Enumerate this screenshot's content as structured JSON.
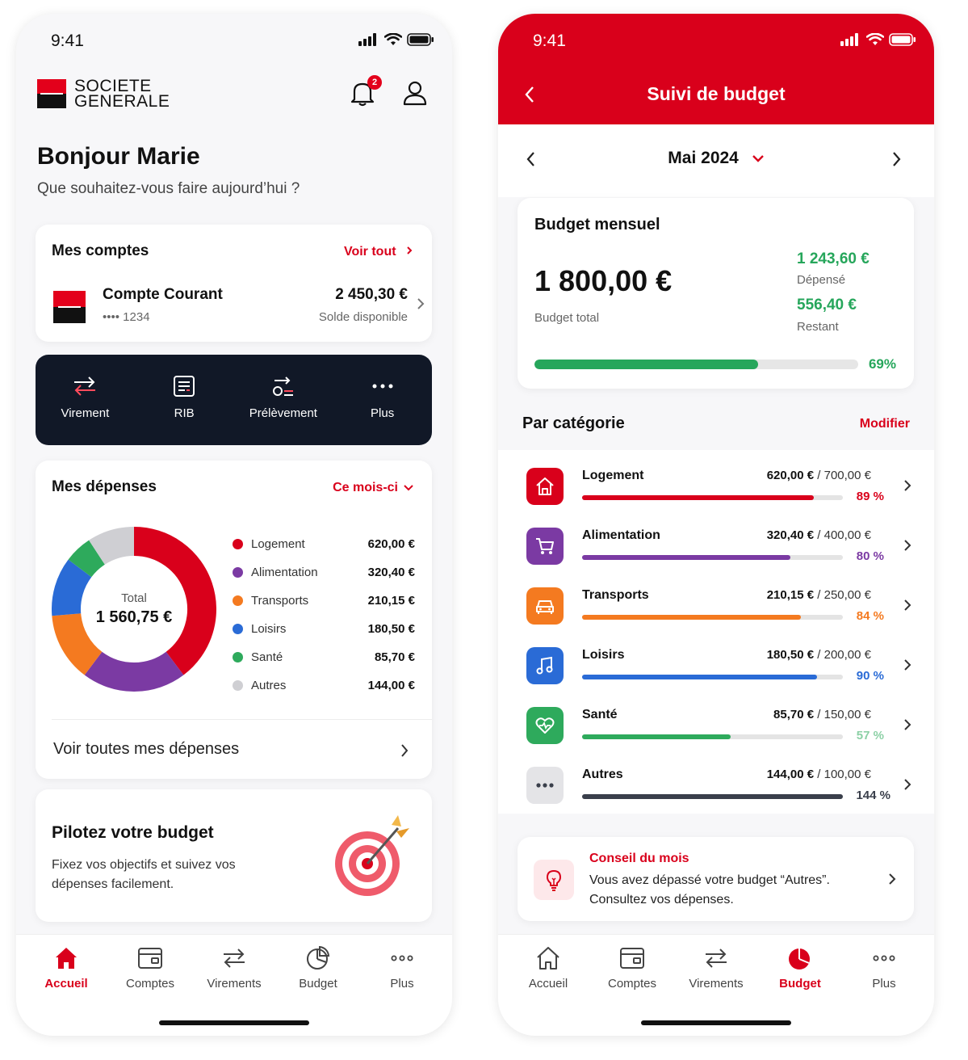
{
  "left": {
    "status": {
      "time": "9:41"
    },
    "brand": {
      "line1": "SOCIETE",
      "line2": "GENERALE"
    },
    "notifications": {
      "count": "2"
    },
    "greeting": {
      "title": "Bonjour Marie",
      "subtitle": "Que souhaitez-vous faire aujourd’hui ?"
    },
    "accounts": {
      "title": "Mes comptes",
      "see_all": "Voir tout",
      "account": {
        "name": "Compte Courant",
        "number": "•••• 1234",
        "balance": "2 450,30 €",
        "balance_label": "Solde disponible"
      }
    },
    "quick_actions": [
      {
        "label": "Virement",
        "icon": "transfer-icon"
      },
      {
        "label": "RIB",
        "icon": "rib-icon"
      },
      {
        "label": "Prélèvement",
        "icon": "direct-debit-icon"
      },
      {
        "label": "Plus",
        "icon": "more-icon"
      }
    ],
    "expenses": {
      "title": "Mes dépenses",
      "period": "Ce mois-ci",
      "total_label": "Total",
      "total": "1 560,75 €",
      "items": [
        {
          "name": "Logement",
          "amount": "620,00 €",
          "value": 620.0,
          "color": "#d9001b"
        },
        {
          "name": "Alimentation",
          "amount": "320,40 €",
          "value": 320.4,
          "color": "#7b3aa3"
        },
        {
          "name": "Transports",
          "amount": "210,15 €",
          "value": 210.15,
          "color": "#f47a20"
        },
        {
          "name": "Loisirs",
          "amount": "180,50 €",
          "value": 180.5,
          "color": "#2a6bd6"
        },
        {
          "name": "Santé",
          "amount": "85,70 €",
          "value": 85.7,
          "color": "#2eaa5c"
        },
        {
          "name": "Autres",
          "amount": "144,00 €",
          "value": 144.0,
          "color": "#cfcfd3"
        }
      ],
      "see_all": "Voir toutes mes dépenses"
    },
    "promo": {
      "title": "Pilotez votre budget",
      "text": "Fixez vos objectifs et suivez vos dépenses facilement."
    },
    "tabs": [
      {
        "label": "Accueil",
        "icon": "home-icon",
        "active": true
      },
      {
        "label": "Comptes",
        "icon": "accounts-icon",
        "active": false
      },
      {
        "label": "Virements",
        "icon": "transfers-icon",
        "active": false
      },
      {
        "label": "Budget",
        "icon": "budget-icon",
        "active": false
      },
      {
        "label": "Plus",
        "icon": "more-icon",
        "active": false
      }
    ]
  },
  "right": {
    "status": {
      "time": "9:41"
    },
    "header": {
      "title": "Suivi de budget"
    },
    "month": {
      "label": "Mai 2024"
    },
    "budget": {
      "title": "Budget mensuel",
      "total": "1 800,00 €",
      "total_label": "Budget total",
      "spent": "1 243,60 €",
      "spent_label": "Dépensé",
      "remaining": "556,40 €",
      "remaining_label": "Restant",
      "progress_pct": "69%",
      "progress_value": 0.69
    },
    "categories_title": "Par catégorie",
    "modify": "Modifier",
    "categories": [
      {
        "name": "Logement",
        "spent": "620,00 €",
        "limit": " / 700,00 €",
        "pct": "89 %",
        "value": 0.89,
        "color": "#d9001b",
        "icon": "house-icon"
      },
      {
        "name": "Alimentation",
        "spent": "320,40 €",
        "limit": " / 400,00 €",
        "pct": "80 %",
        "value": 0.8,
        "color": "#7b3aa3",
        "icon": "cart-icon"
      },
      {
        "name": "Transports",
        "spent": "210,15 €",
        "limit": " / 250,00 €",
        "pct": "84 %",
        "value": 0.84,
        "color": "#f47a20",
        "icon": "car-icon"
      },
      {
        "name": "Loisirs",
        "spent": "180,50 €",
        "limit": " / 200,00 €",
        "pct": "90 %",
        "value": 0.9,
        "color": "#2a6bd6",
        "icon": "music-icon"
      },
      {
        "name": "Santé",
        "spent": "85,70 €",
        "limit": " / 150,00 €",
        "pct": "57 %",
        "value": 0.57,
        "color": "#2eaa5c",
        "icon": "heart-icon"
      },
      {
        "name": "Autres",
        "spent": "144,00 €",
        "limit": " / 100,00 €",
        "pct": "144 %",
        "value": 1.0,
        "color": "#3a3f4b",
        "icon": "dots-icon"
      }
    ],
    "tip": {
      "title": "Conseil du mois",
      "text": "Vous avez dépassé votre budget “Autres”. Consultez vos dépenses."
    },
    "tabs": [
      {
        "label": "Accueil",
        "icon": "home-icon",
        "active": false
      },
      {
        "label": "Comptes",
        "icon": "accounts-icon",
        "active": false
      },
      {
        "label": "Virements",
        "icon": "transfers-icon",
        "active": false
      },
      {
        "label": "Budget",
        "icon": "budget-icon",
        "active": true
      },
      {
        "label": "Plus",
        "icon": "more-icon",
        "active": false
      }
    ]
  }
}
